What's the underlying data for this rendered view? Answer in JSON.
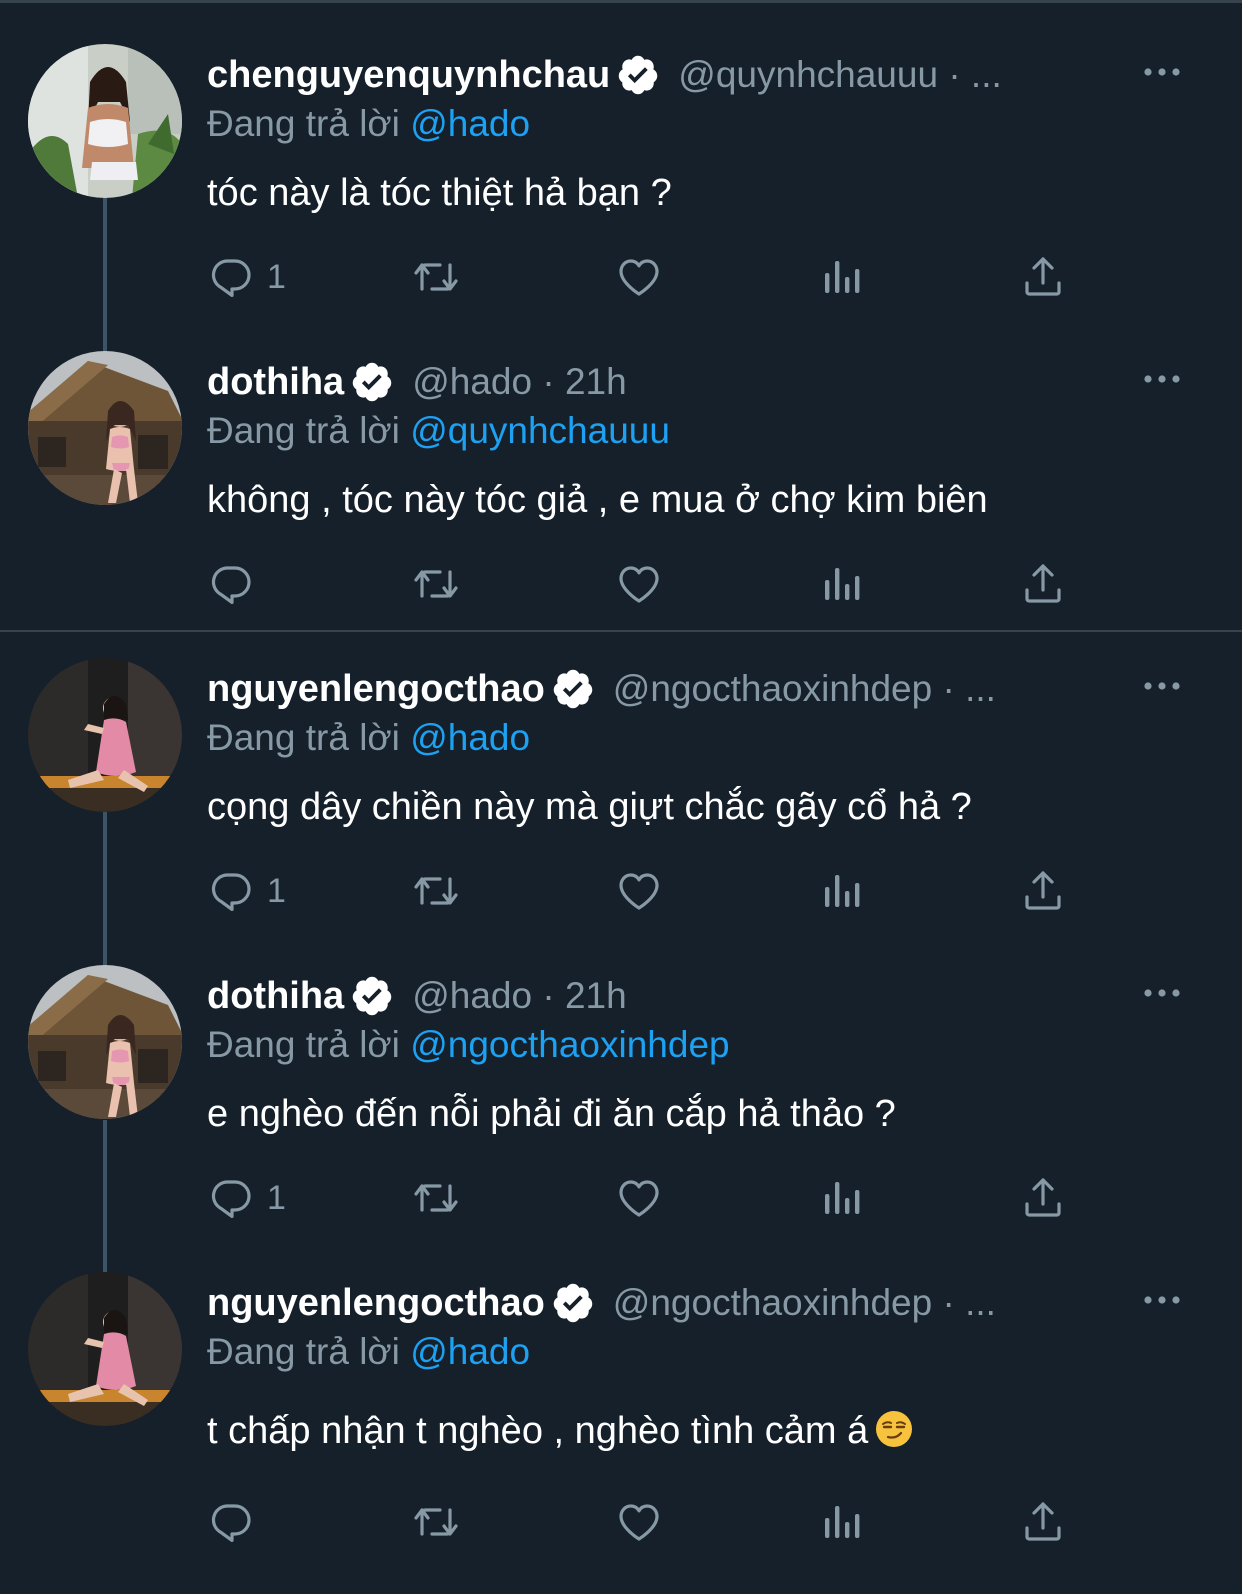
{
  "reply_prefix": "Đang trả lời",
  "colors": {
    "background": "#15202b",
    "muted": "#8899a6",
    "link": "#1da1f2",
    "divider": "#38444d"
  },
  "tweets": [
    {
      "display_name": "chenguyenquynhchau",
      "meta": "@quynhchauuu · ...",
      "reply_to": "@hado",
      "text": "tóc này là tóc thiệt hả bạn ?",
      "reply_count": "1",
      "avatar_icon": "avatar-woman-white-outfit"
    },
    {
      "display_name": "dothiha",
      "meta": "@hado · 21h",
      "reply_to": "@quynhchauuu",
      "text": "không , tóc này tóc giả , e mua ở chợ kim biên",
      "reply_count": "",
      "avatar_icon": "avatar-woman-hut"
    },
    {
      "display_name": "nguyenlengocthao",
      "meta": "@ngocthaoxinhdep · ...",
      "reply_to": "@hado",
      "text": "cọng dây chiền này mà giựt chắc gãy cổ hả ?",
      "reply_count": "1",
      "avatar_icon": "avatar-woman-pink-dress"
    },
    {
      "display_name": "dothiha",
      "meta": "@hado · 21h",
      "reply_to": "@ngocthaoxinhdep",
      "text": "e nghèo đến nỗi phải đi ăn cắp hả thảo ?",
      "reply_count": "1",
      "avatar_icon": "avatar-woman-hut"
    },
    {
      "display_name": "nguyenlengocthao",
      "meta": "@ngocthaoxinhdep · ...",
      "reply_to": "@hado",
      "text": "t chấp nhận t nghèo , nghèo tình cảm á",
      "reply_count": "",
      "avatar_icon": "avatar-woman-pink-dress",
      "emoji": "smirking-face-emoji"
    }
  ]
}
